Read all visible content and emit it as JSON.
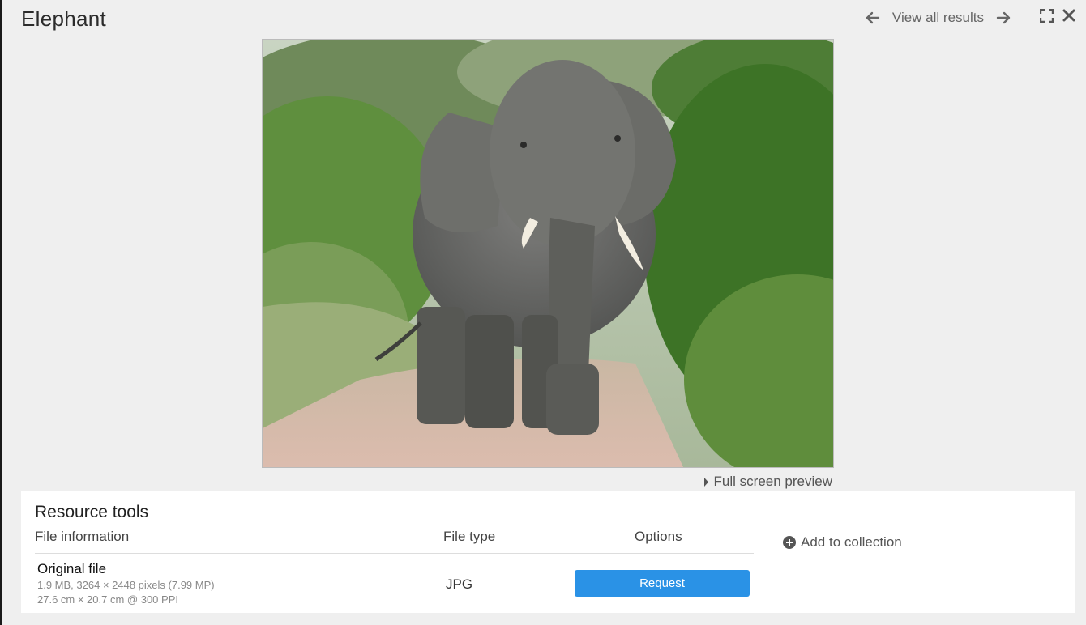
{
  "header": {
    "title": "Elephant",
    "view_all_label": "View all results",
    "prev_icon": "arrow-left-icon",
    "next_icon": "arrow-right-icon",
    "fullscreen_icon": "expand-icon",
    "close_icon": "close-icon"
  },
  "preview": {
    "description_icon": "elephant-photo",
    "fullscreen_label": "Full screen preview"
  },
  "resource_tools": {
    "title": "Resource tools",
    "columns": [
      "File information",
      "File type",
      "Options"
    ],
    "rows": [
      {
        "name": "Original file",
        "meta_line1": "1.9 MB, 3264 × 2448 pixels (7.99 MP)",
        "meta_line2": "27.6 cm × 20.7 cm @ 300 PPI",
        "file_type": "JPG",
        "action_label": "Request"
      }
    ],
    "add_to_collection_label": "Add to collection"
  },
  "colors": {
    "accent": "#2a92e6",
    "background": "#efefef",
    "panel": "#ffffff"
  }
}
